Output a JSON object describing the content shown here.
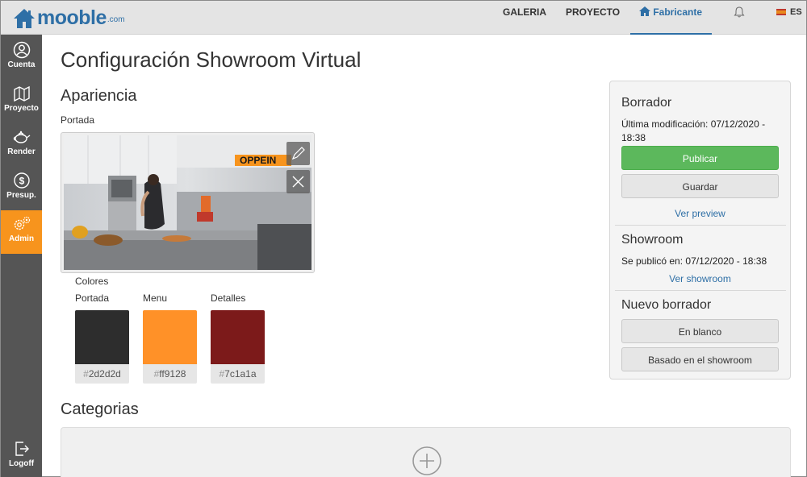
{
  "brand": {
    "name": "mooble",
    "suffix": ".com",
    "color": "#2e6fa6"
  },
  "topnav": {
    "items": [
      {
        "label": "GALERIA"
      },
      {
        "label": "PROYECTO"
      },
      {
        "label": "Fabricante",
        "icon": "house-icon",
        "active": true
      }
    ],
    "bell_icon": "bell-icon",
    "language": "ES"
  },
  "sidebar": {
    "items": [
      {
        "label": "Cuenta",
        "icon": "user-icon"
      },
      {
        "label": "Proyecto",
        "icon": "floorplan-icon"
      },
      {
        "label": "Render",
        "icon": "teapot-icon"
      },
      {
        "label": "Presup.",
        "icon": "dollar-icon"
      },
      {
        "label": "Admin",
        "icon": "gears-icon",
        "active": true
      },
      {
        "label": "Logoff",
        "icon": "logout-icon"
      }
    ],
    "active_color": "#f7941d"
  },
  "main": {
    "title": "Configuración Showroom Virtual",
    "appearance": {
      "title": "Apariencia",
      "cover_label": "Portada",
      "cover_brand_text": "OPPEIN",
      "colors_label": "Colores",
      "colors": [
        {
          "label": "Portada",
          "hex": "2d2d2d",
          "value": "#2d2d2d"
        },
        {
          "label": "Menu",
          "hex": "ff9128",
          "value": "#ff9128"
        },
        {
          "label": "Detalles",
          "hex": "7c1a1a",
          "value": "#7c1a1a"
        }
      ]
    },
    "categories": {
      "title": "Categorias",
      "add_icon": "plus-circle-icon"
    }
  },
  "panel": {
    "draft": {
      "title": "Borrador",
      "modified_label": "Última modificación:",
      "modified_value": "07/12/2020 - 18:38",
      "publish_label": "Publicar",
      "save_label": "Guardar",
      "preview_link": "Ver preview"
    },
    "showroom": {
      "title": "Showroom",
      "published_label": "Se publicó en:",
      "published_value": "07/12/2020 - 18:38",
      "view_link": "Ver showroom"
    },
    "new_draft": {
      "title": "Nuevo borrador",
      "blank_label": "En blanco",
      "based_label": "Basado en el showroom"
    }
  }
}
